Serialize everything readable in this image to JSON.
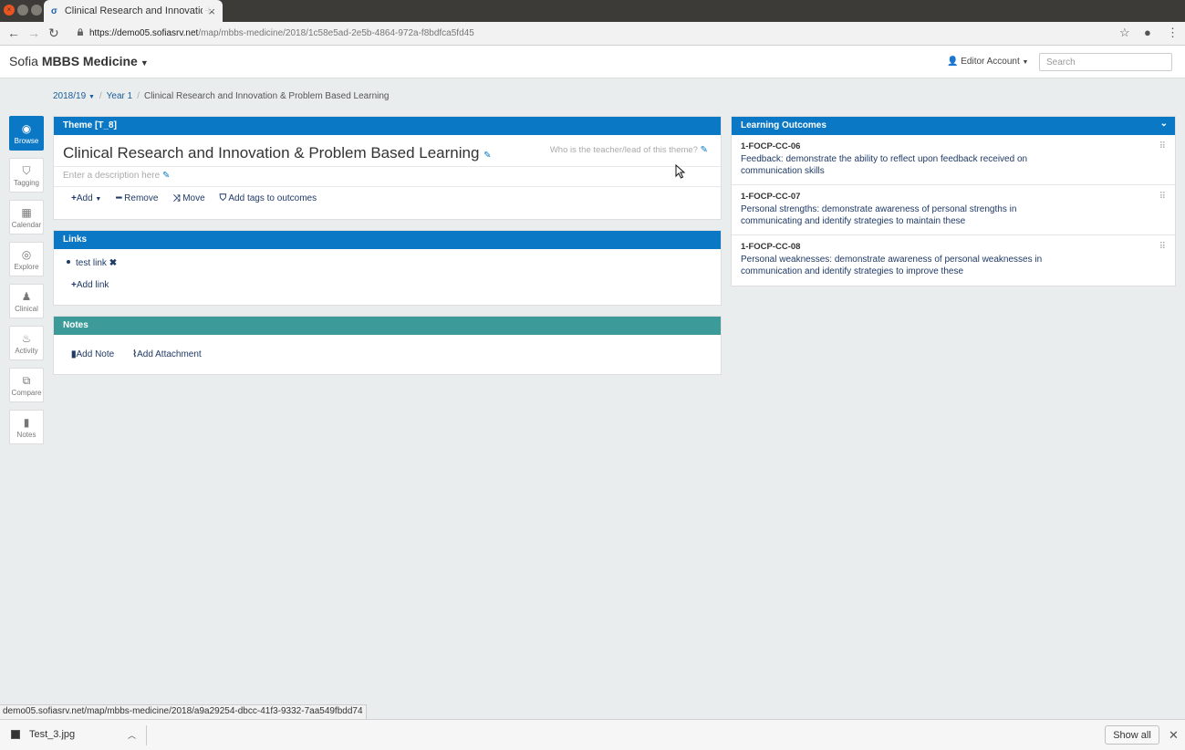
{
  "browser": {
    "tab_title": "Clinical Research and Innovation & Problem Based Learning",
    "tab_favicon": "σ",
    "url_host": "https://demo05.sofiasrv.net",
    "url_path": "/map/mbbs-medicine/2018/1c58e5ad-2e5b-4864-972a-f8bdfca5fd45",
    "status_url": "demo05.sofiasrv.net/map/mbbs-medicine/2018/a9a29254-dbcc-41f3-9332-7aa549fbdd74"
  },
  "header": {
    "brand_prefix": "Sofia",
    "brand_name": "MBBS Medicine",
    "account": "Editor Account",
    "search_placeholder": "Search"
  },
  "breadcrumb": [
    "2018/19",
    "Year 1",
    "Clinical Research and Innovation & Problem Based Learning"
  ],
  "rail": [
    {
      "label": "Browse",
      "icon": "eye-icon",
      "active": true
    },
    {
      "label": "Tagging",
      "icon": "tags-icon",
      "active": false
    },
    {
      "label": "Calendar",
      "icon": "calendar-icon",
      "active": false
    },
    {
      "label": "Explore",
      "icon": "compass-icon",
      "active": false
    },
    {
      "label": "Clinical",
      "icon": "user-md-icon",
      "active": false
    },
    {
      "label": "Activity",
      "icon": "fire-icon",
      "active": false
    },
    {
      "label": "Compare",
      "icon": "copy-icon",
      "active": false
    },
    {
      "label": "Notes",
      "icon": "bookmark-icon",
      "active": false
    }
  ],
  "theme": {
    "header": "Theme [T_8]",
    "title": "Clinical Research and Innovation & Problem Based Learning",
    "lead_placeholder": "Who is the teacher/lead of this theme?",
    "description_placeholder": "Enter a description here",
    "actions": {
      "add": "Add",
      "remove": "Remove",
      "move": "Move",
      "tags": "Add tags to outcomes"
    }
  },
  "links": {
    "header": "Links",
    "items": [
      "test link"
    ],
    "add_label": "Add link"
  },
  "notes": {
    "header": "Notes",
    "add_note": "Add Note",
    "add_attachment": "Add Attachment"
  },
  "outcomes": {
    "header": "Learning Outcomes",
    "items": [
      {
        "code": "1-FOCP-CC-06",
        "text": "Feedback: demonstrate the ability to reflect upon feedback received on communication skills"
      },
      {
        "code": "1-FOCP-CC-07",
        "text": "Personal strengths: demonstrate awareness of personal strengths in communicating and identify strategies to maintain these"
      },
      {
        "code": "1-FOCP-CC-08",
        "text": "Personal weaknesses: demonstrate awareness of personal weaknesses in communication and identify strategies to improve these"
      }
    ]
  },
  "downloads": {
    "file": "Test_3.jpg",
    "show_all": "Show all"
  },
  "colors": {
    "primary": "#0a78c4",
    "notes": "#3c9b98",
    "link": "#1f3a66"
  }
}
